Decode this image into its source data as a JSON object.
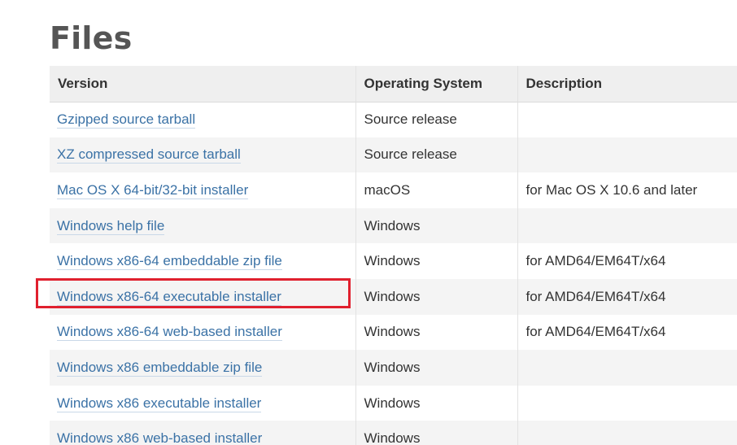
{
  "page": {
    "title": "Files"
  },
  "files_table": {
    "headers": {
      "version": "Version",
      "os": "Operating System",
      "description": "Description"
    },
    "rows": [
      {
        "version": "Gzipped source tarball",
        "os": "Source release",
        "description": ""
      },
      {
        "version": "XZ compressed source tarball",
        "os": "Source release",
        "description": ""
      },
      {
        "version": "Mac OS X 64-bit/32-bit installer",
        "os": "macOS",
        "description": "for Mac OS X 10.6 and later"
      },
      {
        "version": "Windows help file",
        "os": "Windows",
        "description": ""
      },
      {
        "version": "Windows x86-64 embeddable zip file",
        "os": "Windows",
        "description": "for AMD64/EM64T/x64"
      },
      {
        "version": "Windows x86-64 executable installer",
        "os": "Windows",
        "description": "for AMD64/EM64T/x64"
      },
      {
        "version": "Windows x86-64 web-based installer",
        "os": "Windows",
        "description": "for AMD64/EM64T/x64"
      },
      {
        "version": "Windows x86 embeddable zip file",
        "os": "Windows",
        "description": ""
      },
      {
        "version": "Windows x86 executable installer",
        "os": "Windows",
        "description": ""
      },
      {
        "version": "Windows x86 web-based installer",
        "os": "Windows",
        "description": ""
      }
    ]
  },
  "colors": {
    "link": "#3b72a6",
    "highlight": "#e0202e",
    "header_bg": "#efefef",
    "stripe_bg": "#f4f4f4"
  }
}
